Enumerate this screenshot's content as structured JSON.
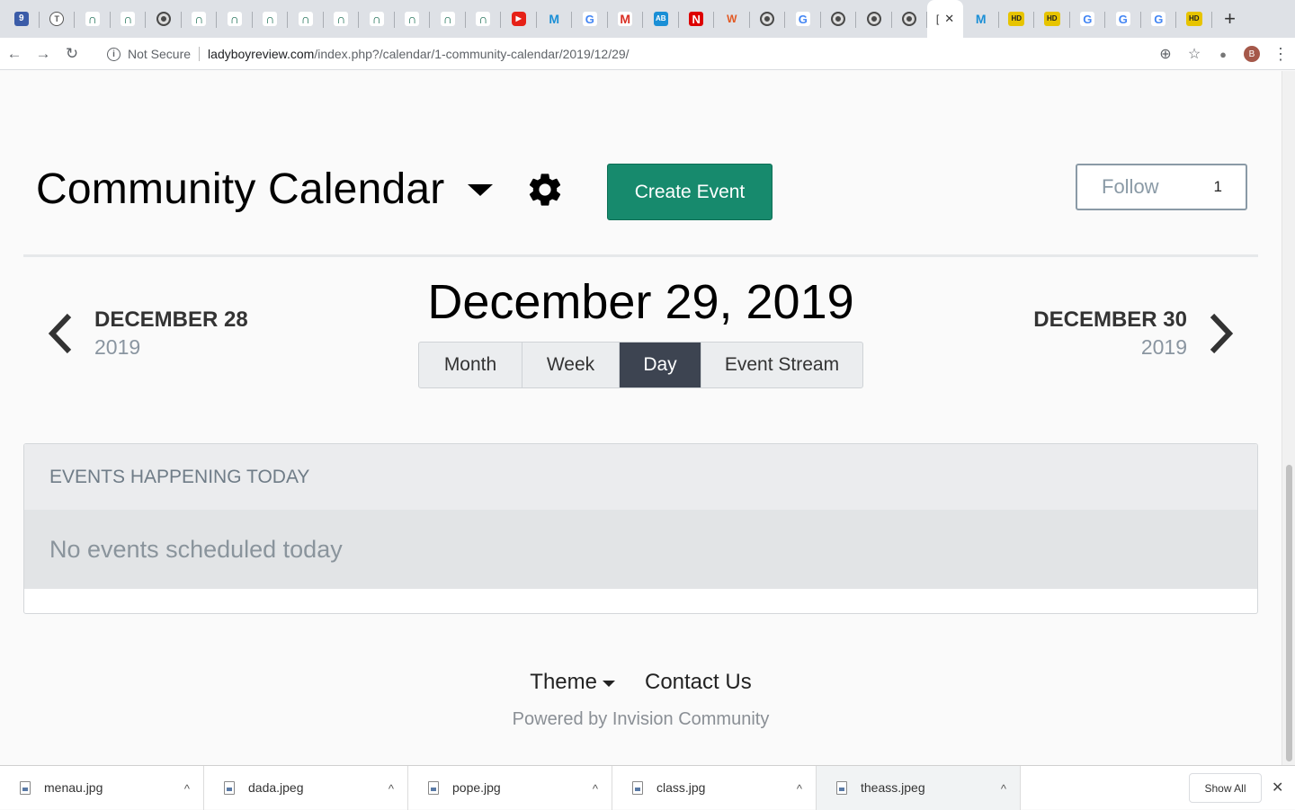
{
  "browser": {
    "tabs": [
      {
        "icon": "map-pin-icon",
        "glyph": "9",
        "style": "f-blue"
      },
      {
        "icon": "t-circle-icon",
        "glyph": "T",
        "style": "f-ring"
      },
      {
        "icon": "green-logo-icon",
        "glyph": "∩",
        "style": "f-green"
      },
      {
        "icon": "green-logo-icon",
        "glyph": "∩",
        "style": "f-green"
      },
      {
        "icon": "globe-icon",
        "glyph": "",
        "style": "f-globe"
      },
      {
        "icon": "green-logo-icon",
        "glyph": "∩",
        "style": "f-green"
      },
      {
        "icon": "green-logo-icon",
        "glyph": "∩",
        "style": "f-green"
      },
      {
        "icon": "green-logo-icon",
        "glyph": "∩",
        "style": "f-green"
      },
      {
        "icon": "green-logo-icon",
        "glyph": "∩",
        "style": "f-green"
      },
      {
        "icon": "green-logo-icon",
        "glyph": "∩",
        "style": "f-green"
      },
      {
        "icon": "green-logo-icon",
        "glyph": "∩",
        "style": "f-green"
      },
      {
        "icon": "green-logo-icon",
        "glyph": "∩",
        "style": "f-green"
      },
      {
        "icon": "green-logo-icon",
        "glyph": "∩",
        "style": "f-green"
      },
      {
        "icon": "green-logo-icon",
        "glyph": "∩",
        "style": "f-green"
      },
      {
        "icon": "youtube-icon",
        "glyph": "▶",
        "style": "f-yt"
      },
      {
        "icon": "m-logo-icon",
        "glyph": "M",
        "style": "f-m"
      },
      {
        "icon": "google-icon",
        "glyph": "G",
        "style": "f-g"
      },
      {
        "icon": "gmail-icon",
        "glyph": "M",
        "style": "f-gm"
      },
      {
        "icon": "ab-logo-icon",
        "glyph": "AB",
        "style": "f-ab"
      },
      {
        "icon": "netflix-icon",
        "glyph": "N",
        "style": "f-n"
      },
      {
        "icon": "w-logo-icon",
        "glyph": "W",
        "style": "f-w"
      },
      {
        "icon": "globe-icon",
        "glyph": "",
        "style": "f-globe"
      },
      {
        "icon": "google-icon",
        "glyph": "G",
        "style": "f-g"
      },
      {
        "icon": "globe-icon",
        "glyph": "",
        "style": "f-globe"
      },
      {
        "icon": "globe-icon",
        "glyph": "",
        "style": "f-globe"
      },
      {
        "icon": "globe-icon",
        "glyph": "",
        "style": "f-globe"
      }
    ],
    "active_tab": {
      "icon": "page-icon",
      "glyph": "[",
      "close": "✕"
    },
    "tabs_after": [
      {
        "icon": "m-logo-icon",
        "glyph": "M",
        "style": "f-m"
      },
      {
        "icon": "hd-logo-icon",
        "glyph": "HD",
        "style": "f-hd"
      },
      {
        "icon": "hd-logo-icon",
        "glyph": "HD",
        "style": "f-hd"
      },
      {
        "icon": "google-icon",
        "glyph": "G",
        "style": "f-g"
      },
      {
        "icon": "google-icon",
        "glyph": "G",
        "style": "f-g"
      },
      {
        "icon": "google-icon",
        "glyph": "G",
        "style": "f-g"
      },
      {
        "icon": "hd-logo-icon",
        "glyph": "HD",
        "style": "f-hd"
      }
    ],
    "new_tab": "+",
    "back": "←",
    "forward": "→",
    "reload": "↻",
    "not_secure": "Not Secure",
    "url_host": "ladyboyreview.com",
    "url_path": "/index.php?/calendar/1-community-calendar/2019/12/29/",
    "zoom_icon": "⊕",
    "star_icon": "☆",
    "ext_icon": "●",
    "avatar_letter": "B",
    "menu_icon": "⋮"
  },
  "header": {
    "title": "Community Calendar",
    "create_event": "Create Event",
    "follow_label": "Follow",
    "follow_count": "1"
  },
  "day_nav": {
    "prev_month": "DECEMBER 28",
    "prev_year": "2019",
    "current": "December 29, 2019",
    "next_month": "DECEMBER 30",
    "next_year": "2019"
  },
  "view_tabs": [
    {
      "label": "Month",
      "active": false
    },
    {
      "label": "Week",
      "active": false
    },
    {
      "label": "Day",
      "active": true
    },
    {
      "label": "Event Stream",
      "active": false
    }
  ],
  "events": {
    "heading": "EVENTS HAPPENING TODAY",
    "empty": "No events scheduled today"
  },
  "footer": {
    "theme": "Theme",
    "contact": "Contact Us",
    "powered": "Powered by Invision Community"
  },
  "downloads": {
    "items": [
      {
        "name": "menau.jpg"
      },
      {
        "name": "dada.jpeg"
      },
      {
        "name": "pope.jpg"
      },
      {
        "name": "class.jpg"
      },
      {
        "name": "theass.jpeg"
      }
    ],
    "caret": "^",
    "show_all": "Show All",
    "close": "✕"
  },
  "colors": {
    "accent": "#178a6d",
    "active_tab": "#3d4451"
  }
}
